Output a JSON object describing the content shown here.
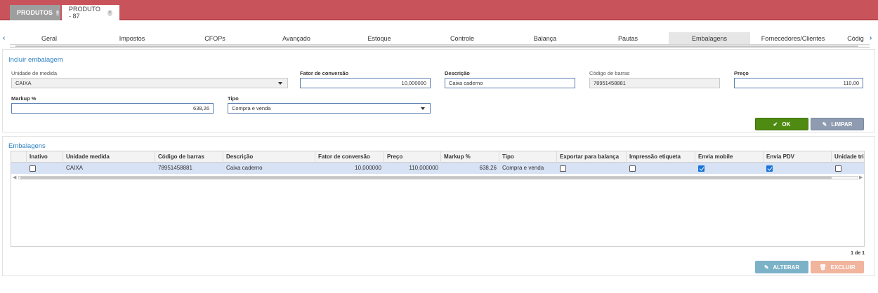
{
  "tabs": [
    {
      "label": "PRODUTOS"
    },
    {
      "label": "PRODUTO - 87"
    }
  ],
  "subtabs": [
    "Geral",
    "Impostos",
    "CFOPs",
    "Avançado",
    "Estoque",
    "Controle",
    "Balança",
    "Pautas",
    "Embalagens",
    "Fornecedores/Clientes",
    "Códig"
  ],
  "active_subtab": "Embalagens",
  "form": {
    "title": "Incluir embalagem",
    "unidade_label": "Unidade de medida",
    "unidade_value": "CAIXA",
    "fator_label": "Fator de conversão",
    "fator_value": "10,000000",
    "descricao_label": "Descrição",
    "descricao_value": "Caixa caderno",
    "codigo_label": "Código de barras",
    "codigo_value": "78951458881",
    "preco_label": "Preço",
    "preco_value": "110,00",
    "markup_label": "Markup %",
    "markup_value": "638,26",
    "tipo_label": "Tipo",
    "tipo_value": "Compra e venda",
    "ok_label": "OK",
    "limpar_label": "LIMPAR"
  },
  "list": {
    "title": "Embalagens",
    "columns": [
      "Inativo",
      "Unidade medida",
      "Código de barras",
      "Descrição",
      "Fator de conversão",
      "Preço",
      "Markup %",
      "Tipo",
      "Exportar para balança",
      "Impressão etiqueta",
      "Envia mobile",
      "Envia PDV",
      "Unidade tri"
    ],
    "rows": [
      {
        "inativo": false,
        "unidade": "CAIXA",
        "codigo": "78951458881",
        "descricao": "Caixa caderno",
        "fator": "10,000000",
        "preco": "110,000000",
        "markup": "638,26",
        "tipo": "Compra e venda",
        "exportar": false,
        "impressao": false,
        "mobile": true,
        "pdv": true,
        "unidade_tri": false
      }
    ],
    "pager": "1 de 1",
    "alterar_label": "ALTERAR",
    "excluir_label": "EXCLUIR"
  },
  "colors": {
    "topbar": "#c9535a",
    "accent": "#2a7fc0",
    "ok": "#4f8b13",
    "row_selected": "#d7e2f5"
  }
}
